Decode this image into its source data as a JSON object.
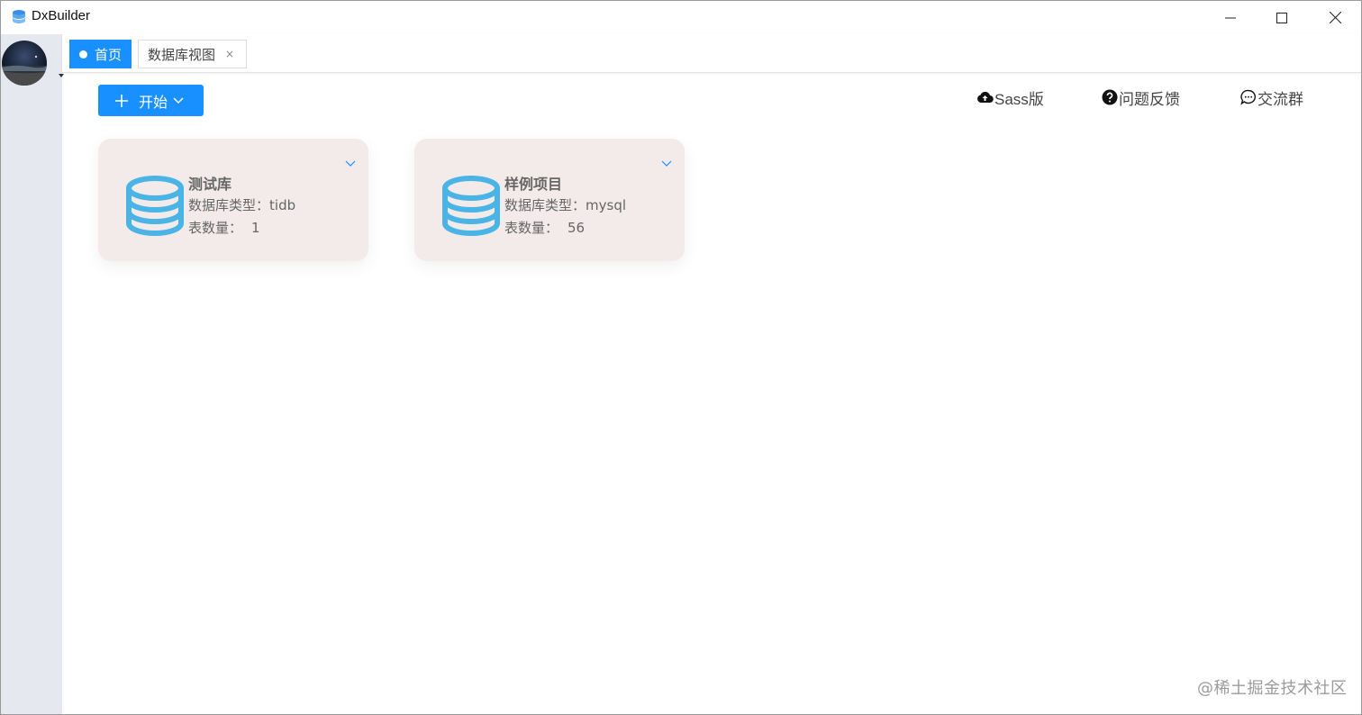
{
  "window": {
    "title": "DxBuilder",
    "controls": [
      "minimize-icon",
      "maximize-icon",
      "close-icon"
    ]
  },
  "tabs": [
    {
      "label": "首页",
      "active": true
    },
    {
      "label": "数据库视图",
      "active": false,
      "close": "×"
    }
  ],
  "toolbar": {
    "start_label": "开始",
    "links": [
      {
        "label": "Sass版",
        "icon": "cloud-upload-icon"
      },
      {
        "label": "问题反馈",
        "icon": "question-circle-icon"
      },
      {
        "label": "交流群",
        "icon": "chat-bubble-icon"
      }
    ]
  },
  "cards": [
    {
      "name": "测试库",
      "type_label": "数据库类型：",
      "type": "tidb",
      "count_label": "表数量：",
      "count": "1"
    },
    {
      "name": "样例项目",
      "type_label": "数据库类型：",
      "type": "mysql",
      "count_label": "表数量：",
      "count": "56"
    }
  ],
  "watermark": "@稀土掘金技术社区",
  "colors": {
    "accent": "#1890ff",
    "card_bg": "#f2ebe9",
    "db_icon": "#4ab4e6",
    "sidebar_bg": "#e5e8ee"
  }
}
